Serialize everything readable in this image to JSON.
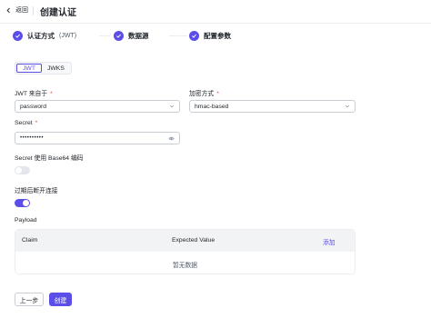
{
  "header": {
    "back_label": "返回",
    "title": "创建认证"
  },
  "steps": [
    {
      "label": "认证方式",
      "sub": "(JWT)"
    },
    {
      "label": "数据源",
      "sub": ""
    },
    {
      "label": "配置参数",
      "sub": ""
    }
  ],
  "tabs": [
    {
      "label": "JWT",
      "active": true
    },
    {
      "label": "JWKS",
      "active": false
    }
  ],
  "form": {
    "jwt_source_label": "JWT 来自于",
    "jwt_source_value": "password",
    "encrypt_label": "加密方式",
    "encrypt_value": "hmac-based",
    "secret_label": "Secret",
    "secret_value": "••••••••••",
    "required_mark": "*",
    "base64_label": "Secret 使用 Base64 编码",
    "base64_enabled": false,
    "expire_label": "过期后断开连接",
    "expire_enabled": true,
    "payload_label": "Payload"
  },
  "payload_table": {
    "columns": [
      "Claim",
      "Expected Value"
    ],
    "add_label": "添加",
    "empty_text": "暂无数据"
  },
  "footer": {
    "prev_label": "上一步",
    "create_label": "创建"
  },
  "colors": {
    "accent": "#5b4ee8",
    "required": "#f53f3f"
  }
}
